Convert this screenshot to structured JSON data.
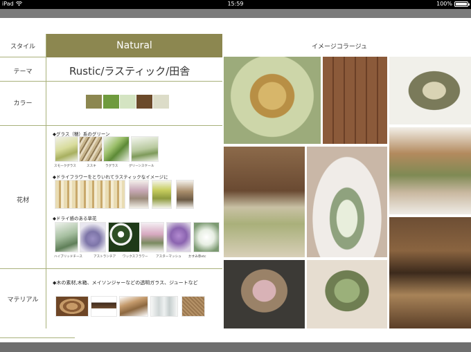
{
  "status_bar": {
    "device": "iPad",
    "time": "15:59",
    "battery": "100%"
  },
  "labels": {
    "style": "スタイル",
    "theme": "テーマ",
    "color": "カラー",
    "flowers": "花材",
    "material": "マテリアル"
  },
  "style_value": "Natural",
  "theme_value": "Rustic/ラスティック/田舎",
  "colors": [
    "#8c8750",
    "#6f9b3e",
    "#d4e4c2",
    "#6b4a2a",
    "#dcdcc8"
  ],
  "flowers": {
    "group1": {
      "title": "◆グラス（穂）系のグリーン",
      "items": [
        "スモークグラス",
        "ススキ",
        "ラグラス",
        "グリーンスケール"
      ]
    },
    "group2": {
      "title": "◆ドライフラワーをとりいれてラスティックなイメージに"
    },
    "group3": {
      "title": "◆ドライ感のある草花",
      "items": [
        "ハイブリッドチース",
        "アストランチア",
        "ワックスフラワー",
        "アスターマッシュ",
        "かすみ草etc"
      ]
    }
  },
  "material": {
    "text": "◆木の素材,木箱、メイソンジャーなどの透明ガラス、ジュートなど"
  },
  "collage": {
    "title": "イメージコラージュ"
  }
}
